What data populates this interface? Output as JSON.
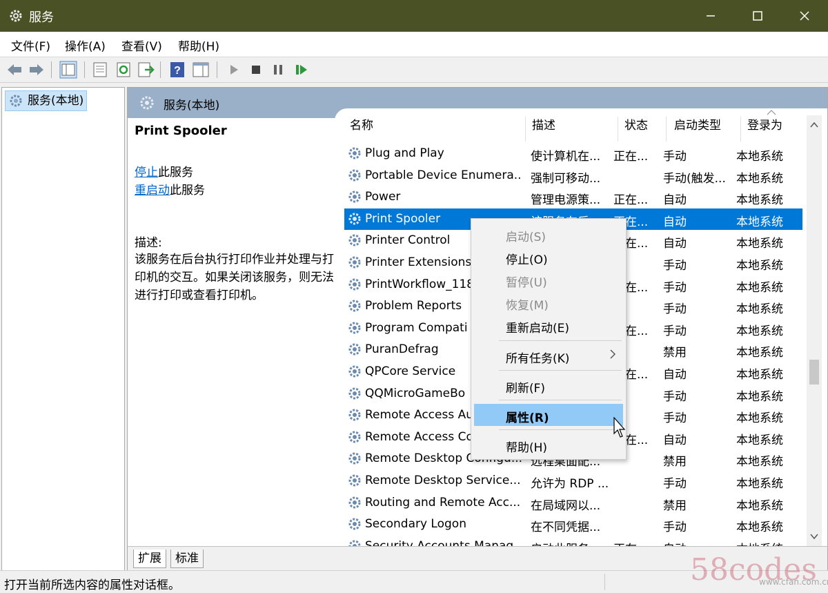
{
  "window": {
    "title": "服务",
    "icon": "gear-icon"
  },
  "menu": [
    "文件(F)",
    "操作(A)",
    "查看(V)",
    "帮助(H)"
  ],
  "tree": {
    "root": "服务(本地)"
  },
  "content_header": "服务(本地)",
  "extended": {
    "service_name": "Print Spooler",
    "stop_link": "停止",
    "stop_suffix": "此服务",
    "restart_link": "重启动",
    "restart_suffix": "此服务",
    "desc_label": "描述:",
    "description": "该服务在后台执行打印作业并处理与打印机的交互。如果关闭该服务，则无法进行打印或查看打印机。"
  },
  "columns": [
    "名称",
    "描述",
    "状态",
    "启动类型",
    "登录为"
  ],
  "rows": [
    {
      "name": "Plug and Play",
      "desc": "使计算机在...",
      "status": "正在...",
      "start": "手动",
      "logon": "本地系统"
    },
    {
      "name": "Portable Device Enumera...",
      "desc": "强制可移动...",
      "status": "",
      "start": "手动(触发...",
      "logon": "本地系统"
    },
    {
      "name": "Power",
      "desc": "管理电源策...",
      "status": "正在...",
      "start": "自动",
      "logon": "本地系统"
    },
    {
      "name": "Print Spooler",
      "desc": "该服务在后...",
      "status": "正在...",
      "start": "自动",
      "logon": "本地系统"
    },
    {
      "name": "Printer Control",
      "desc": "",
      "status": "正在...",
      "start": "自动",
      "logon": "本地系统"
    },
    {
      "name": "Printer Extensions",
      "desc": "",
      "status": "",
      "start": "手动",
      "logon": "本地系统"
    },
    {
      "name": "PrintWorkflow_118",
      "desc": "",
      "status": "正在...",
      "start": "手动",
      "logon": "本地系统"
    },
    {
      "name": "Problem Reports",
      "desc": "",
      "status": "",
      "start": "手动",
      "logon": "本地系统"
    },
    {
      "name": "Program Compati",
      "desc": "",
      "status": "正在...",
      "start": "手动",
      "logon": "本地系统"
    },
    {
      "name": "PuranDefrag",
      "desc": "",
      "status": "",
      "start": "禁用",
      "logon": "本地系统"
    },
    {
      "name": "QPCore Service",
      "desc": "",
      "status": "正在...",
      "start": "自动",
      "logon": "本地系统"
    },
    {
      "name": "QQMicroGameBo",
      "desc": "",
      "status": "",
      "start": "手动",
      "logon": "本地系统"
    },
    {
      "name": "Remote Access Au",
      "desc": "",
      "status": "",
      "start": "手动",
      "logon": "本地系统"
    },
    {
      "name": "Remote Access Co",
      "desc": "",
      "status": "正在...",
      "start": "自动",
      "logon": "本地系统"
    },
    {
      "name": "Remote Desktop Configu...",
      "desc": "远程桌面配...",
      "status": "",
      "start": "禁用",
      "logon": "本地系统"
    },
    {
      "name": "Remote Desktop Service...",
      "desc": "允许为 RDP ...",
      "status": "",
      "start": "手动",
      "logon": "本地系统"
    },
    {
      "name": "Routing and Remote Acc...",
      "desc": "在局域网以...",
      "status": "",
      "start": "禁用",
      "logon": "本地系统"
    },
    {
      "name": "Secondary Logon",
      "desc": "在不同凭据...",
      "status": "",
      "start": "手动",
      "logon": "本地系统"
    },
    {
      "name": "Security Accounts Manag...",
      "desc": "启动此服务...",
      "status": "正在...",
      "start": "自动",
      "logon": "本地系统"
    }
  ],
  "context_menu": {
    "start": "启动(S)",
    "stop": "停止(O)",
    "pause": "暂停(U)",
    "resume": "恢复(M)",
    "restart": "重新启动(E)",
    "all_tasks": "所有任务(K)",
    "refresh": "刷新(F)",
    "properties": "属性(R)",
    "help": "帮助(H)"
  },
  "tabs": [
    "扩展",
    "标准"
  ],
  "status_text": "打开当前所选内容的属性对话框。",
  "watermark": "58codes",
  "watermark_small": "www.cfan.com.cn",
  "colors": {
    "titlebar": "#4a5125",
    "selection": "#0078d7",
    "header": "#9ab0c8",
    "menu_highlight": "#91c9f7"
  }
}
